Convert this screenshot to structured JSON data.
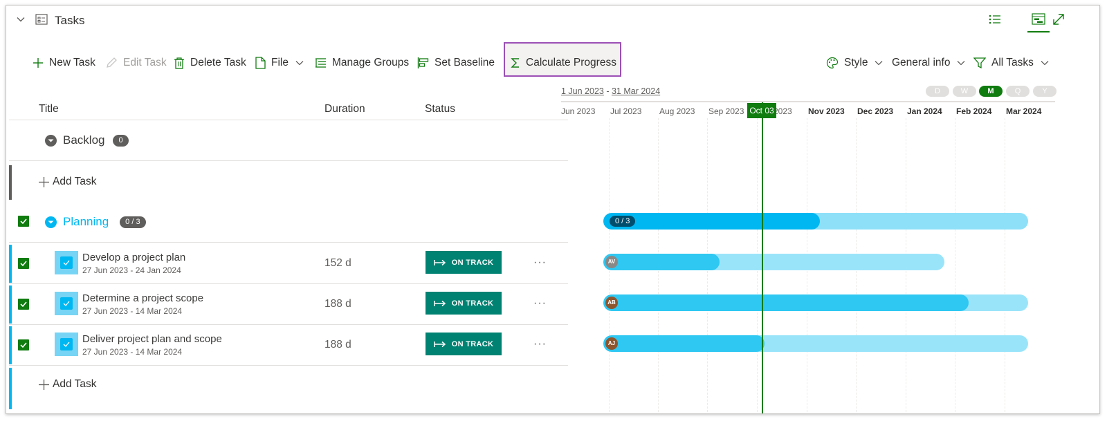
{
  "header": {
    "title": "Tasks"
  },
  "toolbar": {
    "new_task": "New Task",
    "edit_task": "Edit Task",
    "delete_task": "Delete Task",
    "file": "File",
    "manage_groups": "Manage Groups",
    "set_baseline": "Set Baseline",
    "calculate_progress": "Calculate Progress",
    "style": "Style",
    "general_info": "General info",
    "all_tasks": "All Tasks"
  },
  "grid": {
    "columns": {
      "title": "Title",
      "duration": "Duration",
      "status": "Status"
    },
    "add_task_label": "Add Task",
    "groups": [
      {
        "name": "Backlog",
        "count": "0"
      },
      {
        "name": "Planning",
        "count": "0 / 3"
      }
    ],
    "tasks": [
      {
        "name": "Develop a project plan",
        "dates": "27 Jun 2023 - 24 Jan 2024",
        "duration": "152 d",
        "status": "ON TRACK",
        "progress": 0.34,
        "avatar": "AV",
        "more": "···"
      },
      {
        "name": "Determine a project scope",
        "dates": "27 Jun 2023 - 14 Mar 2024",
        "duration": "188 d",
        "status": "ON TRACK",
        "progress": 0.86,
        "avatar": "AB",
        "more": "···"
      },
      {
        "name": "Deliver project plan and scope",
        "dates": "27 Jun 2023 - 14 Mar 2024",
        "duration": "188 d",
        "status": "ON TRACK",
        "progress": 0.38,
        "avatar": "AJ",
        "more": "···"
      }
    ]
  },
  "gantt": {
    "range_start": "1 Jun 2023",
    "range_sep": " - ",
    "range_end": "31 Mar 2024",
    "scales": [
      "D",
      "W",
      "M",
      "Q",
      "Y"
    ],
    "active_scale": "M",
    "months": [
      "Jun 2023",
      "Jul 2023",
      "Aug 2023",
      "Sep 2023",
      "Oct 2023",
      "Nov 2023",
      "Dec 2023",
      "Jan 2024",
      "Feb 2024",
      "Mar 2024"
    ],
    "today_label": "Oct 03",
    "group_badge": "0 / 3",
    "group_progress": 0.51
  },
  "colors": {
    "accent": "#107c10",
    "status_bg": "#008272",
    "bar_fill": "#00b7f1",
    "bar_light": "#8ee0f9",
    "highlight_border": "#9b4fb5"
  }
}
